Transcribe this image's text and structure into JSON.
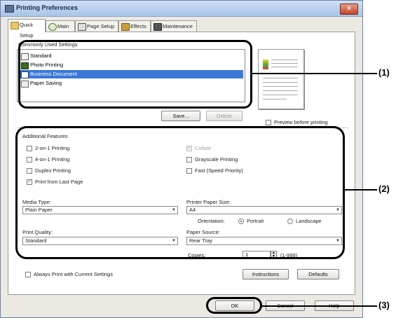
{
  "window": {
    "title": "Printing Preferences",
    "close_label": "×"
  },
  "tabs": [
    {
      "label": "Quick Setup",
      "active": true
    },
    {
      "label": "Main"
    },
    {
      "label": "Page Setup"
    },
    {
      "label": "Effects"
    },
    {
      "label": "Maintenance"
    }
  ],
  "quick_setup": {
    "commonly_used_label": "Commonly Used Settings",
    "items": [
      {
        "label": "Standard"
      },
      {
        "label": "Photo Printing"
      },
      {
        "label": "Business Document",
        "selected": true
      },
      {
        "label": "Paper Saving"
      }
    ],
    "save_label": "Save...",
    "delete_label": "Delete",
    "preview_label": "Preview before printing"
  },
  "additional": {
    "heading": "Additional Features",
    "left": [
      {
        "label": "2-on-1 Printing",
        "checked": false
      },
      {
        "label": "4-on-1 Printing",
        "checked": false
      },
      {
        "label": "Duplex Printing",
        "checked": false
      },
      {
        "label": "Print from Last Page",
        "checked": true
      }
    ],
    "right": [
      {
        "label": "Collate",
        "checked": true,
        "disabled": true
      },
      {
        "label": "Grayscale Printing",
        "checked": false
      },
      {
        "label": "Fast (Speed Priority)",
        "checked": false
      }
    ]
  },
  "settings": {
    "media_type_label": "Media Type:",
    "media_type_value": "Plain Paper",
    "paper_size_label": "Printer Paper Size:",
    "paper_size_value": "A4",
    "orientation_label": "Orientation:",
    "portrait_label": "Portrait",
    "landscape_label": "Landscape",
    "print_quality_label": "Print Quality:",
    "print_quality_value": "Standard",
    "paper_source_label": "Paper Source:",
    "paper_source_value": "Rear Tray",
    "copies_label": "Copies:",
    "copies_value": "1",
    "copies_range": "(1-999)"
  },
  "footer": {
    "always_print_label": "Always Print with Current Settings",
    "instructions_label": "Instructions",
    "defaults_label": "Defaults",
    "ok_label": "OK",
    "cancel_label": "Cancel",
    "help_label": "Help"
  },
  "callouts": {
    "one": "(1)",
    "two": "(2)",
    "three": "(3)"
  },
  "colors": {
    "selection": "#3b78d6",
    "highlight_outline": "#000000"
  }
}
